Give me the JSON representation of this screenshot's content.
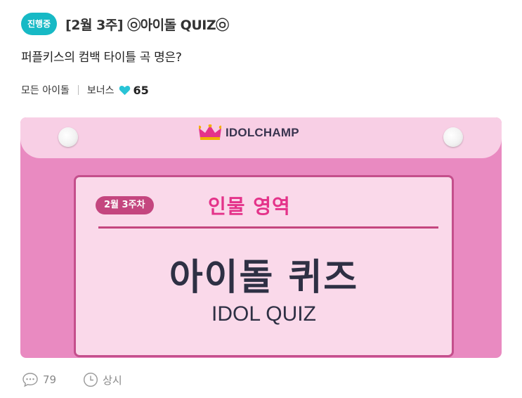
{
  "header": {
    "status_badge": "진행중",
    "title": "[2월 3주] ㉧아이돌 QUIZ㉧"
  },
  "question": "퍼플키스의 컴백 타이틀 곡 명은?",
  "meta": {
    "category": "모든 아이돌",
    "bonus_label": "보너스",
    "bonus_value": "65",
    "heart_color": "#29c4d6"
  },
  "banner": {
    "logo_text": "IDOLCHAMP",
    "week_label": "2월 3주차",
    "area_label": "인물 영역",
    "quiz_title_ko": "아이돌 퀴즈",
    "quiz_title_en": "IDOL QUIZ"
  },
  "footer": {
    "comment_count": "79",
    "time_label": "상시"
  }
}
